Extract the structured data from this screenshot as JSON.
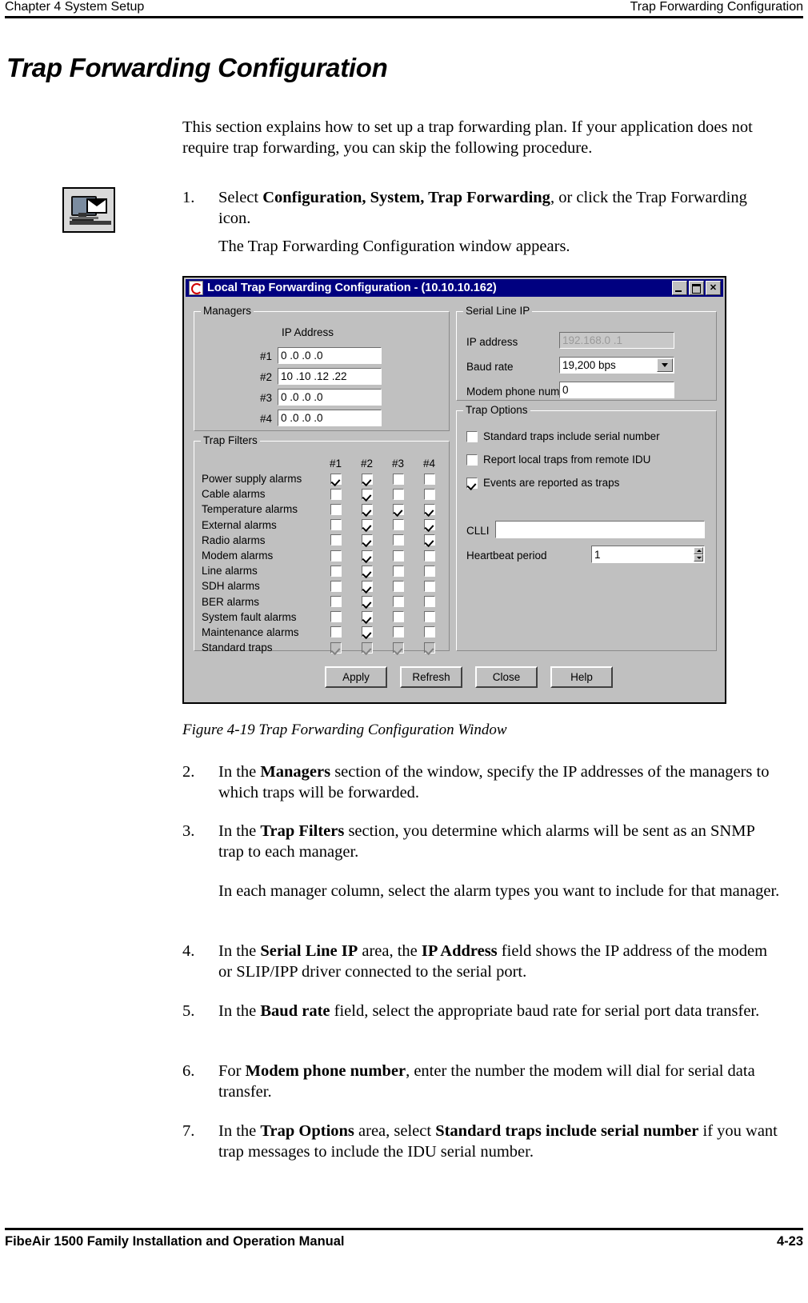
{
  "running_head": {
    "left": "Chapter 4  System Setup",
    "right": "Trap Forwarding Configuration"
  },
  "section_title": "Trap Forwarding Configuration",
  "intro": "This section explains how to set up a trap forwarding plan. If your application does not require trap forwarding, you can skip the following procedure.",
  "steps": [
    {
      "num": "1.",
      "parts": [
        {
          "t": "Select ",
          "b": false
        },
        {
          "t": "Configuration, System, Trap Forwarding",
          "b": true
        },
        {
          "t": ", or click the Trap Forwarding icon.",
          "b": false
        }
      ],
      "sub": "The Trap Forwarding Configuration window appears."
    },
    {
      "num": "2.",
      "parts": [
        {
          "t": "In the ",
          "b": false
        },
        {
          "t": "Managers",
          "b": true
        },
        {
          "t": " section of the window, specify the IP addresses of the managers to which traps will be forwarded.",
          "b": false
        }
      ]
    },
    {
      "num": "3.",
      "parts": [
        {
          "t": "In the ",
          "b": false
        },
        {
          "t": "Trap Filters",
          "b": true
        },
        {
          "t": " section, you determine which alarms will be sent as an SNMP trap to each manager.",
          "b": false
        }
      ],
      "sub": "In each manager column, select the alarm types you want to include for that manager."
    },
    {
      "num": "4.",
      "parts": [
        {
          "t": "In the ",
          "b": false
        },
        {
          "t": "Serial Line IP",
          "b": true
        },
        {
          "t": " area, the ",
          "b": false
        },
        {
          "t": "IP Address",
          "b": true
        },
        {
          "t": " field shows the IP address of the modem or SLIP/IPP driver connected to the serial port.",
          "b": false
        }
      ]
    },
    {
      "num": "5.",
      "parts": [
        {
          "t": "In the ",
          "b": false
        },
        {
          "t": "Baud rate",
          "b": true
        },
        {
          "t": " field, select the appropriate baud rate for serial port data transfer.",
          "b": false
        }
      ]
    },
    {
      "num": "6.",
      "parts": [
        {
          "t": "For ",
          "b": false
        },
        {
          "t": "Modem phone number",
          "b": true
        },
        {
          "t": ", enter the number the modem will dial for serial data transfer.",
          "b": false
        }
      ]
    },
    {
      "num": "7.",
      "parts": [
        {
          "t": "In the ",
          "b": false
        },
        {
          "t": "Trap Options",
          "b": true
        },
        {
          "t": " area, select ",
          "b": false
        },
        {
          "t": "Standard traps include serial number",
          "b": true
        },
        {
          "t": " if you want trap messages to include the IDU serial number.",
          "b": false
        }
      ]
    }
  ],
  "figure_caption": "Figure 4-19  Trap Forwarding Configuration Window",
  "dialog": {
    "title": "Local Trap Forwarding Configuration - (10.10.10.162)",
    "title_icon": "app-logo-icon",
    "window_buttons": [
      "minimize",
      "maximize",
      "close"
    ],
    "managers": {
      "group_label": "Managers",
      "column_header": "IP Address",
      "rows": [
        {
          "label": "#1",
          "value": "0  .0  .0  .0"
        },
        {
          "label": "#2",
          "value": "10 .10 .12 .22"
        },
        {
          "label": "#3",
          "value": "0  .0  .0  .0"
        },
        {
          "label": "#4",
          "value": "0  .0  .0  .0"
        }
      ]
    },
    "serial_line_ip": {
      "group_label": "Serial Line IP",
      "ip_address_label": "IP address",
      "ip_address_value": "192.168.0  .1",
      "ip_address_disabled": true,
      "baud_rate_label": "Baud rate",
      "baud_rate_value": "19,200 bps",
      "modem_phone_label": "Modem phone number",
      "modem_phone_value": "0"
    },
    "trap_filters": {
      "group_label": "Trap Filters",
      "columns": [
        "#1",
        "#2",
        "#3",
        "#4"
      ],
      "rows": [
        {
          "label": "Power supply alarms",
          "checks": [
            true,
            true,
            false,
            false
          ],
          "disabled": false
        },
        {
          "label": "Cable alarms",
          "checks": [
            false,
            true,
            false,
            false
          ],
          "disabled": false
        },
        {
          "label": "Temperature alarms",
          "checks": [
            false,
            true,
            true,
            true
          ],
          "disabled": false
        },
        {
          "label": "External alarms",
          "checks": [
            false,
            true,
            false,
            true
          ],
          "disabled": false
        },
        {
          "label": "Radio alarms",
          "checks": [
            false,
            true,
            false,
            true
          ],
          "disabled": false
        },
        {
          "label": "Modem alarms",
          "checks": [
            false,
            true,
            false,
            false
          ],
          "disabled": false
        },
        {
          "label": "Line alarms",
          "checks": [
            false,
            true,
            false,
            false
          ],
          "disabled": false
        },
        {
          "label": "SDH alarms",
          "checks": [
            false,
            true,
            false,
            false
          ],
          "disabled": false
        },
        {
          "label": "BER alarms",
          "checks": [
            false,
            true,
            false,
            false
          ],
          "disabled": false
        },
        {
          "label": "System fault alarms",
          "checks": [
            false,
            true,
            false,
            false
          ],
          "disabled": false
        },
        {
          "label": "Maintenance alarms",
          "checks": [
            false,
            true,
            false,
            false
          ],
          "disabled": false
        },
        {
          "label": "Standard traps",
          "checks": [
            true,
            true,
            true,
            true
          ],
          "disabled": true
        }
      ]
    },
    "trap_options": {
      "group_label": "Trap Options",
      "checkboxes": [
        {
          "label": "Standard traps include serial number",
          "checked": false
        },
        {
          "label": "Report local traps from remote IDU",
          "checked": false
        },
        {
          "label": "Events are reported as traps",
          "checked": true
        }
      ],
      "clli_label": "CLLI",
      "clli_value": "",
      "heartbeat_label": "Heartbeat period",
      "heartbeat_value": "1"
    },
    "buttons": [
      "Apply",
      "Refresh",
      "Close",
      "Help"
    ]
  },
  "footer": {
    "left": "FibeAir 1500 Family Installation and Operation Manual",
    "right": "4-23"
  },
  "colors": {
    "titlebar": "#000080",
    "dialog_face": "#c0c0c0",
    "field_bg": "#ffffff",
    "disabled_text": "#9a9a9a"
  }
}
